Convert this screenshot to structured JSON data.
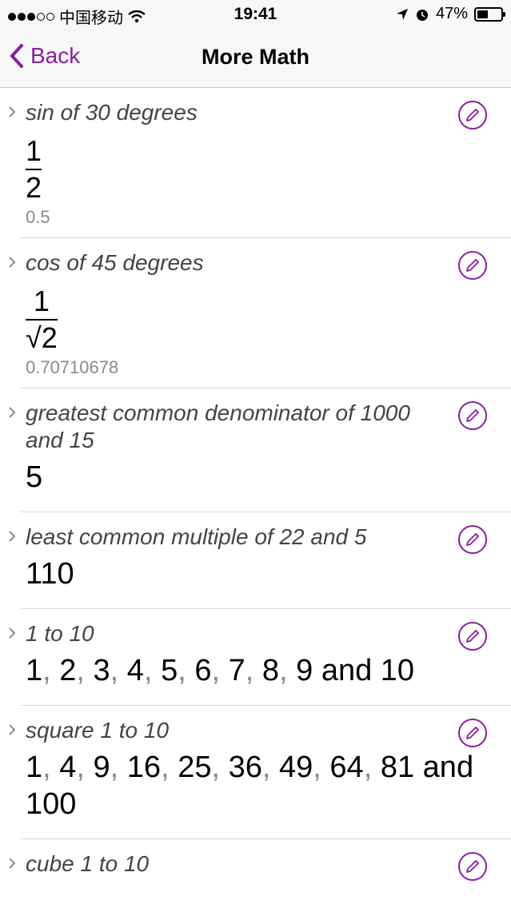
{
  "status": {
    "carrier": "中国移动",
    "time": "19:41",
    "battery": "47%",
    "battery_level": 0.47
  },
  "nav": {
    "back_label": "Back",
    "title": "More Math"
  },
  "colors": {
    "accent": "#8a1e9f"
  },
  "rows": [
    {
      "query": "sin of 30 degrees",
      "num": "1",
      "den": "2",
      "approx": "0.5"
    },
    {
      "query": "cos of 45 degrees",
      "num": "1",
      "den": "√2",
      "approx": "0.70710678"
    },
    {
      "query": "greatest common denominator of 1000 and 15",
      "answer": "5"
    },
    {
      "query": "least common multiple of 22 and 5",
      "answer": "110"
    },
    {
      "query": "1 to 10",
      "items": [
        "1",
        "2",
        "3",
        "4",
        "5",
        "6",
        "7",
        "8",
        "9"
      ],
      "last": "10",
      "conj": "and"
    },
    {
      "query": "square 1 to 10",
      "items": [
        "1",
        "4",
        "9",
        "16",
        "25",
        "36",
        "49",
        "64",
        "81"
      ],
      "last": "100",
      "conj": "and"
    },
    {
      "query": "cube 1 to 10"
    }
  ]
}
